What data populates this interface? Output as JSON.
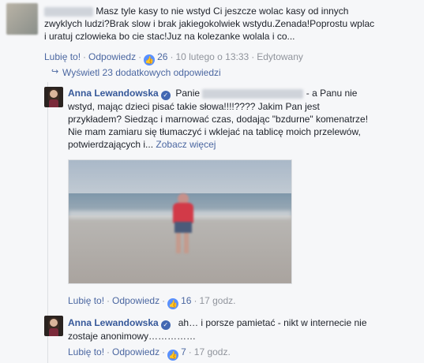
{
  "comment1": {
    "author_blurred": true,
    "text_line1": "Masz tyle kasy to nie wstyd Ci jeszcze wolac kasy od innych",
    "text_line2": "zwyklych ludzi?Brak slow i brak jakiegokolwiek wstydu.Zenada!Poprostu wplac",
    "text_line3": "i uratuj czlowieka bo cie stac!Juz na kolezanke wolala i co...",
    "like_label": "Lubię to!",
    "reply_label": "Odpowiedz",
    "reaction_count": "26",
    "timestamp": "10 lutego o 13:33",
    "edited_label": "Edytowany"
  },
  "more_replies": {
    "label": "Wyświetl 23 dodatkowych odpowiedzi"
  },
  "reply1": {
    "author": "Anna Lewandowska",
    "text_prefix": "Panie",
    "text_line1_suffix": "- a Panu nie",
    "text_line2": "wstyd, mając dzieci pisać takie słowa!!!!???? Jakim Pan jest",
    "text_line3": "przykładem? Siedząc i marnować czas, dodając \"bzdurne\" komenatrze!",
    "text_line4": "Nie mam zamiaru się tłumaczyć i wklejać na tablicę moich przelewów,",
    "text_line5": "potwierdzających i...",
    "see_more": "Zobacz więcej",
    "like_label": "Lubię to!",
    "reply_label": "Odpowiedz",
    "reaction_count": "16",
    "timestamp": "17 godz."
  },
  "reply2": {
    "author": "Anna Lewandowska",
    "text_line1": "ah… i porsze pamietać - nikt w internecie nie",
    "text_line2": "zostaje anonimowy……………",
    "like_label": "Lubię to!",
    "reply_label": "Odpowiedz",
    "reaction_count": "7",
    "timestamp": "17 godz."
  },
  "colors": {
    "link": "#365899",
    "meta": "#90949c",
    "background": "#f6f7f9",
    "reaction": "#5890ff"
  },
  "icons": [
    "thumbs-up-reaction-icon",
    "verified-badge-icon",
    "reply-arrow-icon"
  ]
}
